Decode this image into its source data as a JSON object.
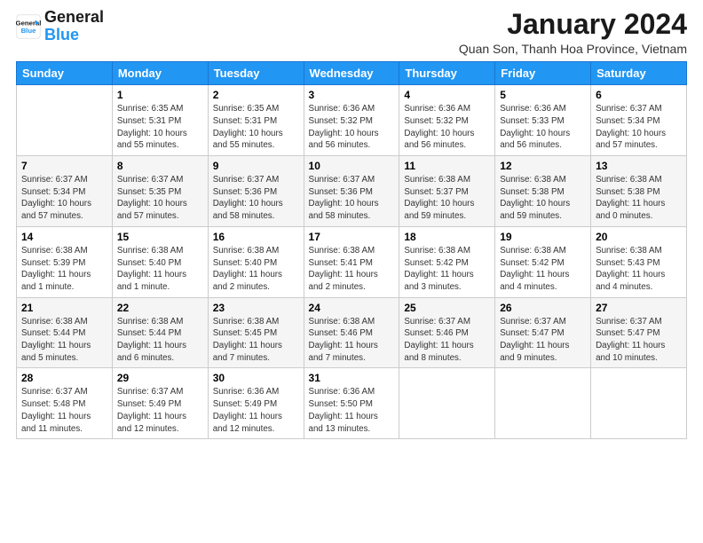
{
  "logo": {
    "text_general": "General",
    "text_blue": "Blue"
  },
  "header": {
    "title": "January 2024",
    "subtitle": "Quan Son, Thanh Hoa Province, Vietnam"
  },
  "weekdays": [
    "Sunday",
    "Monday",
    "Tuesday",
    "Wednesday",
    "Thursday",
    "Friday",
    "Saturday"
  ],
  "weeks": [
    [
      {
        "day": "",
        "sunrise": "",
        "sunset": "",
        "daylight": ""
      },
      {
        "day": "1",
        "sunrise": "Sunrise: 6:35 AM",
        "sunset": "Sunset: 5:31 PM",
        "daylight": "Daylight: 10 hours and 55 minutes."
      },
      {
        "day": "2",
        "sunrise": "Sunrise: 6:35 AM",
        "sunset": "Sunset: 5:31 PM",
        "daylight": "Daylight: 10 hours and 55 minutes."
      },
      {
        "day": "3",
        "sunrise": "Sunrise: 6:36 AM",
        "sunset": "Sunset: 5:32 PM",
        "daylight": "Daylight: 10 hours and 56 minutes."
      },
      {
        "day": "4",
        "sunrise": "Sunrise: 6:36 AM",
        "sunset": "Sunset: 5:32 PM",
        "daylight": "Daylight: 10 hours and 56 minutes."
      },
      {
        "day": "5",
        "sunrise": "Sunrise: 6:36 AM",
        "sunset": "Sunset: 5:33 PM",
        "daylight": "Daylight: 10 hours and 56 minutes."
      },
      {
        "day": "6",
        "sunrise": "Sunrise: 6:37 AM",
        "sunset": "Sunset: 5:34 PM",
        "daylight": "Daylight: 10 hours and 57 minutes."
      }
    ],
    [
      {
        "day": "7",
        "sunrise": "Sunrise: 6:37 AM",
        "sunset": "Sunset: 5:34 PM",
        "daylight": "Daylight: 10 hours and 57 minutes."
      },
      {
        "day": "8",
        "sunrise": "Sunrise: 6:37 AM",
        "sunset": "Sunset: 5:35 PM",
        "daylight": "Daylight: 10 hours and 57 minutes."
      },
      {
        "day": "9",
        "sunrise": "Sunrise: 6:37 AM",
        "sunset": "Sunset: 5:36 PM",
        "daylight": "Daylight: 10 hours and 58 minutes."
      },
      {
        "day": "10",
        "sunrise": "Sunrise: 6:37 AM",
        "sunset": "Sunset: 5:36 PM",
        "daylight": "Daylight: 10 hours and 58 minutes."
      },
      {
        "day": "11",
        "sunrise": "Sunrise: 6:38 AM",
        "sunset": "Sunset: 5:37 PM",
        "daylight": "Daylight: 10 hours and 59 minutes."
      },
      {
        "day": "12",
        "sunrise": "Sunrise: 6:38 AM",
        "sunset": "Sunset: 5:38 PM",
        "daylight": "Daylight: 10 hours and 59 minutes."
      },
      {
        "day": "13",
        "sunrise": "Sunrise: 6:38 AM",
        "sunset": "Sunset: 5:38 PM",
        "daylight": "Daylight: 11 hours and 0 minutes."
      }
    ],
    [
      {
        "day": "14",
        "sunrise": "Sunrise: 6:38 AM",
        "sunset": "Sunset: 5:39 PM",
        "daylight": "Daylight: 11 hours and 1 minute."
      },
      {
        "day": "15",
        "sunrise": "Sunrise: 6:38 AM",
        "sunset": "Sunset: 5:40 PM",
        "daylight": "Daylight: 11 hours and 1 minute."
      },
      {
        "day": "16",
        "sunrise": "Sunrise: 6:38 AM",
        "sunset": "Sunset: 5:40 PM",
        "daylight": "Daylight: 11 hours and 2 minutes."
      },
      {
        "day": "17",
        "sunrise": "Sunrise: 6:38 AM",
        "sunset": "Sunset: 5:41 PM",
        "daylight": "Daylight: 11 hours and 2 minutes."
      },
      {
        "day": "18",
        "sunrise": "Sunrise: 6:38 AM",
        "sunset": "Sunset: 5:42 PM",
        "daylight": "Daylight: 11 hours and 3 minutes."
      },
      {
        "day": "19",
        "sunrise": "Sunrise: 6:38 AM",
        "sunset": "Sunset: 5:42 PM",
        "daylight": "Daylight: 11 hours and 4 minutes."
      },
      {
        "day": "20",
        "sunrise": "Sunrise: 6:38 AM",
        "sunset": "Sunset: 5:43 PM",
        "daylight": "Daylight: 11 hours and 4 minutes."
      }
    ],
    [
      {
        "day": "21",
        "sunrise": "Sunrise: 6:38 AM",
        "sunset": "Sunset: 5:44 PM",
        "daylight": "Daylight: 11 hours and 5 minutes."
      },
      {
        "day": "22",
        "sunrise": "Sunrise: 6:38 AM",
        "sunset": "Sunset: 5:44 PM",
        "daylight": "Daylight: 11 hours and 6 minutes."
      },
      {
        "day": "23",
        "sunrise": "Sunrise: 6:38 AM",
        "sunset": "Sunset: 5:45 PM",
        "daylight": "Daylight: 11 hours and 7 minutes."
      },
      {
        "day": "24",
        "sunrise": "Sunrise: 6:38 AM",
        "sunset": "Sunset: 5:46 PM",
        "daylight": "Daylight: 11 hours and 7 minutes."
      },
      {
        "day": "25",
        "sunrise": "Sunrise: 6:37 AM",
        "sunset": "Sunset: 5:46 PM",
        "daylight": "Daylight: 11 hours and 8 minutes."
      },
      {
        "day": "26",
        "sunrise": "Sunrise: 6:37 AM",
        "sunset": "Sunset: 5:47 PM",
        "daylight": "Daylight: 11 hours and 9 minutes."
      },
      {
        "day": "27",
        "sunrise": "Sunrise: 6:37 AM",
        "sunset": "Sunset: 5:47 PM",
        "daylight": "Daylight: 11 hours and 10 minutes."
      }
    ],
    [
      {
        "day": "28",
        "sunrise": "Sunrise: 6:37 AM",
        "sunset": "Sunset: 5:48 PM",
        "daylight": "Daylight: 11 hours and 11 minutes."
      },
      {
        "day": "29",
        "sunrise": "Sunrise: 6:37 AM",
        "sunset": "Sunset: 5:49 PM",
        "daylight": "Daylight: 11 hours and 12 minutes."
      },
      {
        "day": "30",
        "sunrise": "Sunrise: 6:36 AM",
        "sunset": "Sunset: 5:49 PM",
        "daylight": "Daylight: 11 hours and 12 minutes."
      },
      {
        "day": "31",
        "sunrise": "Sunrise: 6:36 AM",
        "sunset": "Sunset: 5:50 PM",
        "daylight": "Daylight: 11 hours and 13 minutes."
      },
      {
        "day": "",
        "sunrise": "",
        "sunset": "",
        "daylight": ""
      },
      {
        "day": "",
        "sunrise": "",
        "sunset": "",
        "daylight": ""
      },
      {
        "day": "",
        "sunrise": "",
        "sunset": "",
        "daylight": ""
      }
    ]
  ]
}
